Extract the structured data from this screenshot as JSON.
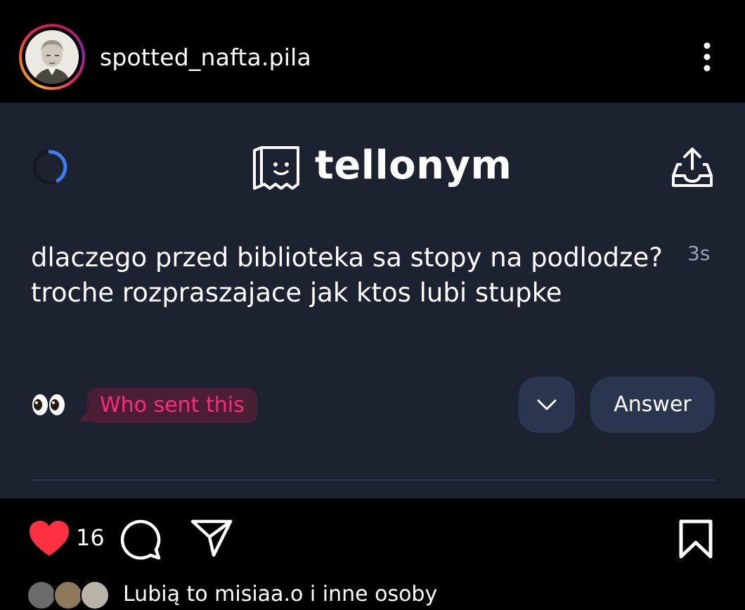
{
  "header": {
    "username": "spotted_nafta.pila",
    "avatar_icon": "portrait-avatar",
    "menu_icon": "more-vertical-icon"
  },
  "card": {
    "brand": "tellonym",
    "question": "dlaczego przed biblioteka sa stopy na podlodze? troche rozpraszajace jak ktos lubi stupke",
    "time": "3s",
    "eyes": "👀",
    "who_sent": "Who sent this",
    "answer_label": "Answer",
    "colors": {
      "card_bg": "#1c2230",
      "accent_pink": "#ff2a7a",
      "button_bg": "#2a3650",
      "spinner": "#3d7df2"
    }
  },
  "actions": {
    "like_count": "16",
    "liked_by": "Lubią to misiaa.o i inne osoby",
    "heart_color": "#ff3040"
  }
}
